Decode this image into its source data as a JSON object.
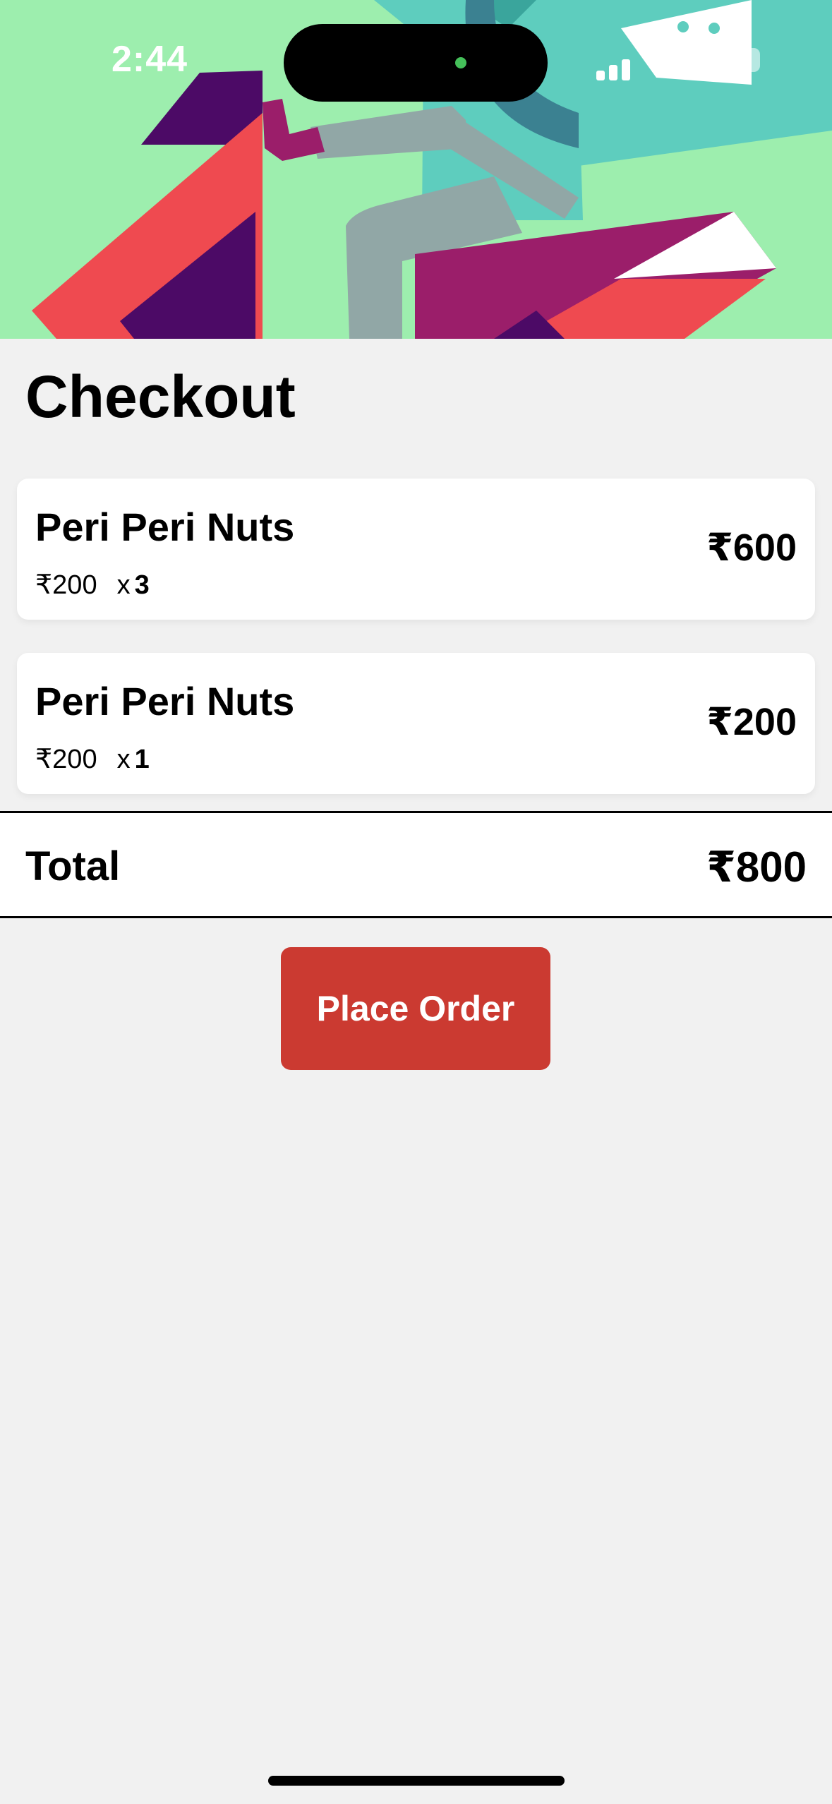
{
  "status_bar": {
    "time": "2:44"
  },
  "header": {
    "title": "Checkout"
  },
  "cart": {
    "items": [
      {
        "name": "Peri Peri Nuts",
        "unit_price": "₹200",
        "qty_prefix": "x",
        "qty": "3",
        "line_total": "₹600"
      },
      {
        "name": "Peri Peri Nuts",
        "unit_price": "₹200",
        "qty_prefix": "x",
        "qty": "1",
        "line_total": "₹200"
      }
    ]
  },
  "summary": {
    "total_label": "Total",
    "total_value": "₹800"
  },
  "actions": {
    "place_order_label": "Place Order"
  },
  "colors": {
    "hero_bg": "#9deeae",
    "accent_button": "#cb3a31",
    "page_bg": "#f1f1f1"
  }
}
